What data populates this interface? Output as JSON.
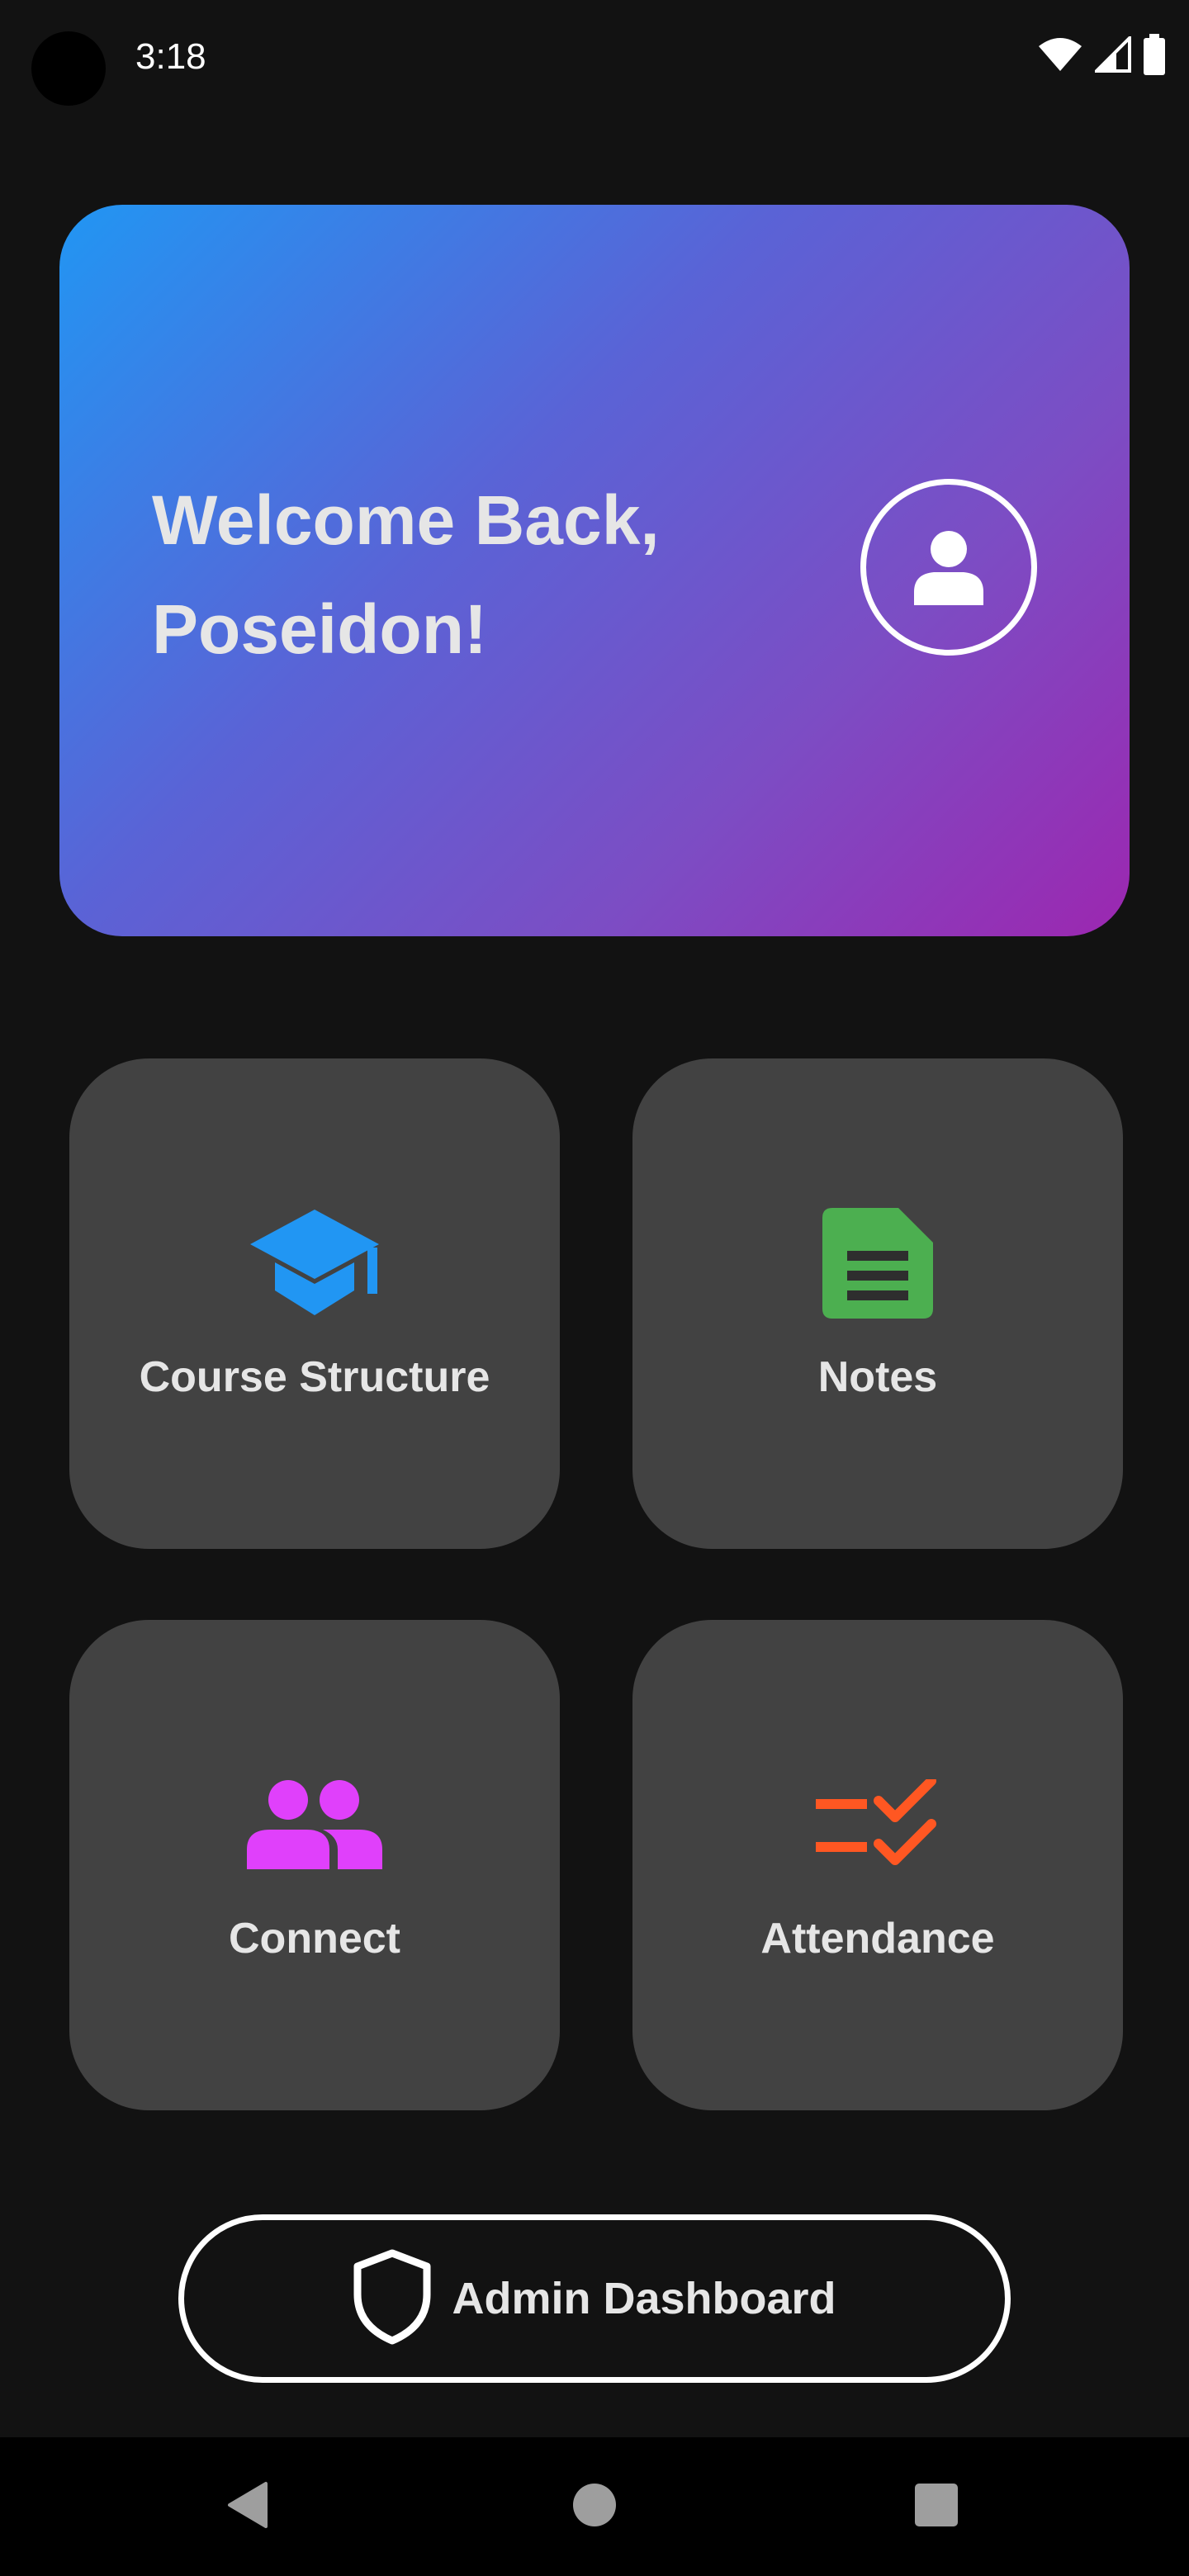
{
  "status_bar": {
    "time": "3:18",
    "icons": [
      "wifi-icon",
      "cell-signal-icon",
      "battery-icon"
    ]
  },
  "welcome": {
    "line1": "Welcome Back,",
    "line2": "Poseidon!",
    "avatar_icon": "person-icon"
  },
  "tiles": [
    {
      "label": "Course Structure",
      "icon": "graduation-cap-icon",
      "color": "#2196f3"
    },
    {
      "label": "Notes",
      "icon": "document-icon",
      "color": "#4caf50"
    },
    {
      "label": "Connect",
      "icon": "people-icon",
      "color": "#e040fb"
    },
    {
      "label": "Attendance",
      "icon": "checklist-icon",
      "color": "#ff5722"
    }
  ],
  "admin_button": {
    "label": "Admin Dashboard",
    "icon": "shield-icon"
  },
  "nav_bar": {
    "buttons": [
      "back-icon",
      "home-icon",
      "recents-icon"
    ]
  },
  "colors": {
    "background": "#121212",
    "card_gradient_start": "#2196f3",
    "card_gradient_end": "#9c27b0",
    "tile_background": "#424242"
  }
}
